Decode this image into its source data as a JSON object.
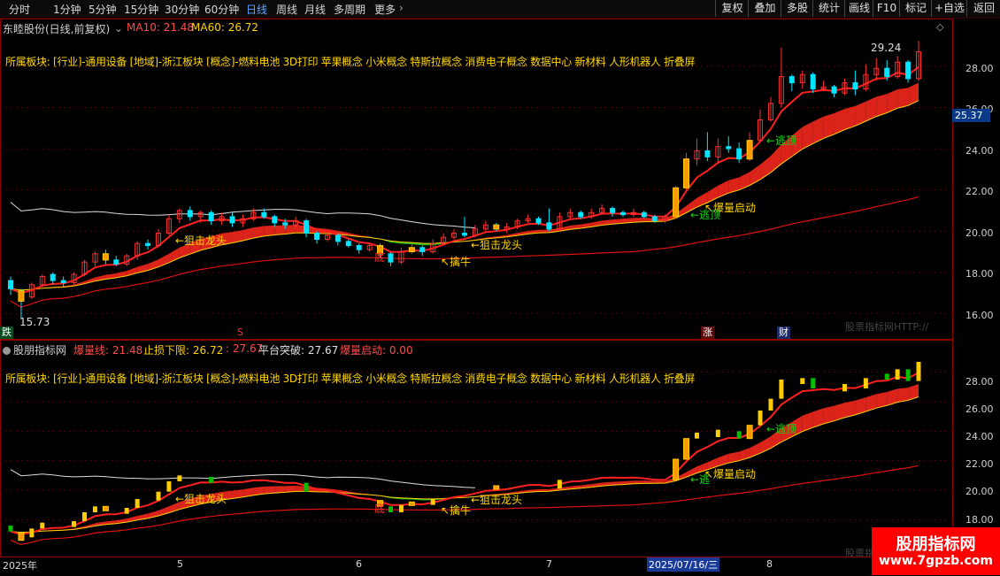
{
  "toolbar": {
    "periods": [
      "分时",
      "1分钟",
      "5分钟",
      "15分钟",
      "30分钟",
      "60分钟",
      "日线",
      "周线",
      "月线",
      "多周期",
      "更多"
    ],
    "active_period": "日线",
    "buttons": [
      "复权",
      "叠加",
      "多股",
      "统计",
      "画线",
      "F10",
      "标记",
      "+自选",
      "返回"
    ]
  },
  "main": {
    "stock_name": "东睦股份(日线,前复权)",
    "ma10_label": "MA10: 21.48",
    "ma60_label": "MA60: 26.72",
    "sector_text": "所属板块: [行业]-通用设备 [地域]-浙江板块 [概念]-燃料电池 3D打印 苹果概念 小米概念 特斯拉概念 消费电子概念 数据中心 新材料 人形机器人 折叠屏",
    "price_ticks": [
      "28.00",
      "26.00",
      "24.00",
      "22.00",
      "20.00",
      "18.00",
      "16.00"
    ],
    "current_price": "25.37",
    "high_label": "29.24",
    "low_label": "15.73",
    "annotations": {
      "snipe1": "←狙击龙头",
      "snipe2": "←狙击龙头",
      "catch_cow": "↖擒牛",
      "escape": "←逃顶",
      "breakout": "↖爆量启动",
      "escape2": "←逃顶",
      "bottom": "底"
    },
    "events": {
      "fall": "跌",
      "s": "S",
      "rise": "涨",
      "fin": "财"
    },
    "watermark": "股票指标网HTTP://"
  },
  "sub": {
    "name": "股朋指标网",
    "bl_label": "爆量线: 21.48",
    "stop_label": "止损下限: 26.72",
    "stop_val2": ": 27.67",
    "platform_label": "平台突破: 27.67",
    "start_label": "爆量启动: 0.00",
    "sector_text": "所属板块: [行业]-通用设备 [地域]-浙江板块 [概念]-燃料电池 3D打印 苹果概念 小米概念 特斯拉概念 消费电子概念 数据中心 新材料 人形机器人 折叠屏",
    "price_ticks": [
      "28.00",
      "26.00",
      "24.00",
      "22.00",
      "20.00",
      "18.00"
    ],
    "annotations": {
      "snipe1": "←狙击龙头",
      "snipe2": "←狙击龙头",
      "catch_cow": "↖擒牛",
      "escape": "←逃顶",
      "breakout": "↖爆量启动",
      "escape2": "←逃",
      "bottom": "底"
    },
    "watermark": "股票指"
  },
  "date_axis": [
    "2025年",
    "5",
    "6",
    "7",
    "2025/07/16/三",
    "8"
  ],
  "badge": {
    "title": "股朋指标网",
    "url": "www.7gpzb.com"
  },
  "colors": {
    "up": "#ff3030",
    "down": "#00e5ff",
    "ma_band": "#e8251a",
    "ma_band_green": "#19c31a",
    "accent": "#ffd700"
  },
  "chart_data": {
    "type": "candlestick",
    "ylim": [
      15.5,
      29.8
    ],
    "candles": [
      [
        17.6,
        17.2,
        17.8,
        16.9
      ],
      [
        17.1,
        16.6,
        17.2,
        15.73
      ],
      [
        16.8,
        17.4,
        17.5,
        16.7
      ],
      [
        17.4,
        17.8,
        17.9,
        17.2
      ],
      [
        17.9,
        17.6,
        18.0,
        17.4
      ],
      [
        17.6,
        17.5,
        17.8,
        17.3
      ],
      [
        17.5,
        17.9,
        18.0,
        17.3
      ],
      [
        17.9,
        18.5,
        18.6,
        17.8
      ],
      [
        18.5,
        18.9,
        19.0,
        18.3
      ],
      [
        18.9,
        18.6,
        19.1,
        18.4
      ],
      [
        18.6,
        18.4,
        18.8,
        18.3
      ],
      [
        18.4,
        18.8,
        18.9,
        18.3
      ],
      [
        18.8,
        19.4,
        19.5,
        18.6
      ],
      [
        19.4,
        19.3,
        19.6,
        19.1
      ],
      [
        19.3,
        19.9,
        20.1,
        19.2
      ],
      [
        19.9,
        20.6,
        20.8,
        19.8
      ],
      [
        20.6,
        21.0,
        21.1,
        20.4
      ],
      [
        21.0,
        20.7,
        21.2,
        20.5
      ],
      [
        20.7,
        20.9,
        21.0,
        20.4
      ],
      [
        20.9,
        20.5,
        21.0,
        20.3
      ],
      [
        20.5,
        20.7,
        20.9,
        20.3
      ],
      [
        20.7,
        20.4,
        20.9,
        20.2
      ],
      [
        20.4,
        20.6,
        20.8,
        20.2
      ],
      [
        20.6,
        20.9,
        21.1,
        20.5
      ],
      [
        20.9,
        20.7,
        21.1,
        20.6
      ],
      [
        20.7,
        20.4,
        20.8,
        20.2
      ],
      [
        20.4,
        20.3,
        20.6,
        20.1
      ],
      [
        20.3,
        20.5,
        20.7,
        20.1
      ],
      [
        20.5,
        19.9,
        20.6,
        19.7
      ],
      [
        19.9,
        19.6,
        20.0,
        19.4
      ],
      [
        19.6,
        19.8,
        19.9,
        19.5
      ],
      [
        19.8,
        19.5,
        19.9,
        19.3
      ],
      [
        19.5,
        19.3,
        19.6,
        19.2
      ],
      [
        19.3,
        19.1,
        19.4,
        18.9
      ],
      [
        19.1,
        19.3,
        19.4,
        19.0
      ],
      [
        19.3,
        18.9,
        19.4,
        18.7
      ],
      [
        18.9,
        18.5,
        19.0,
        18.3
      ],
      [
        18.5,
        19.0,
        19.2,
        18.4
      ],
      [
        19.0,
        19.2,
        19.4,
        18.9
      ],
      [
        19.2,
        19.0,
        19.3,
        18.8
      ],
      [
        19.0,
        19.4,
        19.6,
        18.9
      ],
      [
        19.4,
        19.7,
        19.9,
        19.3
      ],
      [
        19.7,
        19.9,
        20.1,
        19.6
      ],
      [
        19.9,
        19.8,
        20.7,
        19.7
      ],
      [
        19.8,
        20.1,
        20.3,
        19.7
      ],
      [
        20.1,
        20.3,
        20.5,
        20.0
      ],
      [
        20.3,
        20.1,
        20.4,
        20.0
      ],
      [
        20.1,
        20.2,
        20.4,
        19.9
      ],
      [
        20.2,
        20.5,
        20.6,
        20.1
      ],
      [
        20.5,
        20.6,
        20.8,
        20.4
      ],
      [
        20.6,
        20.4,
        20.7,
        20.3
      ],
      [
        20.4,
        20.1,
        21.1,
        20.0
      ],
      [
        20.1,
        20.7,
        20.9,
        20.0
      ],
      [
        20.7,
        20.9,
        21.1,
        20.6
      ],
      [
        20.9,
        20.7,
        21.0,
        20.6
      ],
      [
        20.7,
        20.9,
        21.1,
        20.6
      ],
      [
        20.9,
        21.1,
        21.3,
        20.8
      ],
      [
        21.1,
        20.9,
        21.2,
        20.7
      ],
      [
        20.9,
        20.8,
        21.0,
        20.7
      ],
      [
        20.8,
        20.9,
        21.1,
        20.7
      ],
      [
        20.9,
        20.7,
        21.0,
        20.6
      ],
      [
        20.7,
        20.5,
        20.8,
        20.4
      ],
      [
        20.5,
        20.7,
        20.8,
        20.4
      ],
      [
        20.7,
        22.1,
        22.2,
        20.6
      ],
      [
        22.1,
        23.5,
        23.8,
        22.0
      ],
      [
        23.5,
        23.9,
        24.5,
        23.2
      ],
      [
        23.9,
        23.6,
        24.8,
        23.4
      ],
      [
        23.6,
        24.1,
        24.5,
        23.3
      ],
      [
        24.1,
        24.0,
        24.6,
        23.8
      ],
      [
        24.0,
        23.5,
        24.3,
        23.3
      ],
      [
        23.5,
        24.4,
        24.8,
        23.4
      ],
      [
        24.4,
        25.4,
        25.9,
        24.3
      ],
      [
        25.4,
        26.2,
        26.5,
        25.3
      ],
      [
        26.2,
        27.5,
        28.9,
        26.0
      ],
      [
        27.5,
        27.2,
        27.6,
        26.8
      ],
      [
        27.2,
        27.6,
        27.8,
        26.9
      ],
      [
        27.6,
        26.9,
        27.7,
        26.7
      ],
      [
        26.9,
        27.0,
        27.3,
        26.8
      ],
      [
        27.0,
        26.7,
        27.1,
        26.5
      ],
      [
        26.7,
        27.2,
        27.4,
        26.6
      ],
      [
        27.2,
        26.9,
        27.8,
        26.6
      ],
      [
        26.9,
        27.6,
        28.1,
        26.8
      ],
      [
        27.6,
        27.9,
        28.4,
        27.3
      ],
      [
        27.9,
        27.5,
        28.3,
        27.3
      ],
      [
        27.5,
        28.2,
        28.5,
        27.4
      ],
      [
        28.2,
        27.4,
        28.3,
        27.2
      ],
      [
        27.4,
        28.7,
        29.24,
        27.3
      ]
    ]
  }
}
